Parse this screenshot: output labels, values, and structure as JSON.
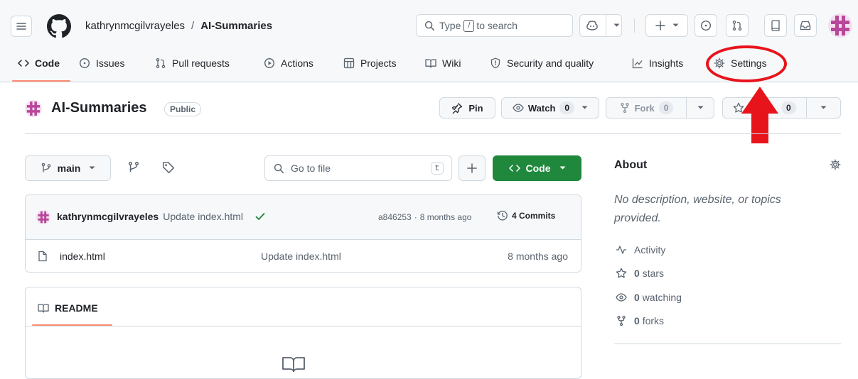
{
  "header": {
    "owner": "kathrynmcgilvrayeles",
    "separator": "/",
    "repo": "AI-Summaries",
    "search_prefix": "Type",
    "search_key": "/",
    "search_suffix": "to search"
  },
  "tabs": [
    {
      "label": "Code"
    },
    {
      "label": "Issues"
    },
    {
      "label": "Pull requests"
    },
    {
      "label": "Actions"
    },
    {
      "label": "Projects"
    },
    {
      "label": "Wiki"
    },
    {
      "label": "Security and quality"
    },
    {
      "label": "Insights"
    },
    {
      "label": "Settings"
    }
  ],
  "repo_header": {
    "name": "AI-Summaries",
    "visibility": "Public",
    "pin_label": "Pin",
    "watch_label": "Watch",
    "watch_count": "0",
    "fork_label": "Fork",
    "fork_count": "0",
    "star_count": "0"
  },
  "file_nav": {
    "branch": "main",
    "goto_placeholder": "Go to file",
    "goto_key": "t",
    "code_button": "Code"
  },
  "commit": {
    "author": "kathrynmcgilvrayeles",
    "message": "Update index.html",
    "hash": "a846253",
    "dot": "·",
    "age": "8 months ago",
    "commits_label": "4 Commits"
  },
  "files": [
    {
      "name": "index.html",
      "message": "Update index.html",
      "age": "8 months ago"
    }
  ],
  "readme": {
    "tab_label": "README"
  },
  "about": {
    "title": "About",
    "description": "No description, website, or topics provided.",
    "activity": "Activity",
    "stars_count": "0",
    "stars_label": "stars",
    "watching_count": "0",
    "watching_label": "watching",
    "forks_count": "0",
    "forks_label": "forks"
  },
  "annotation": {
    "color": "#e8141b"
  },
  "colors": {
    "accent": "#fd8c73",
    "code_button": "#1f883d",
    "success": "#1a7f37"
  }
}
